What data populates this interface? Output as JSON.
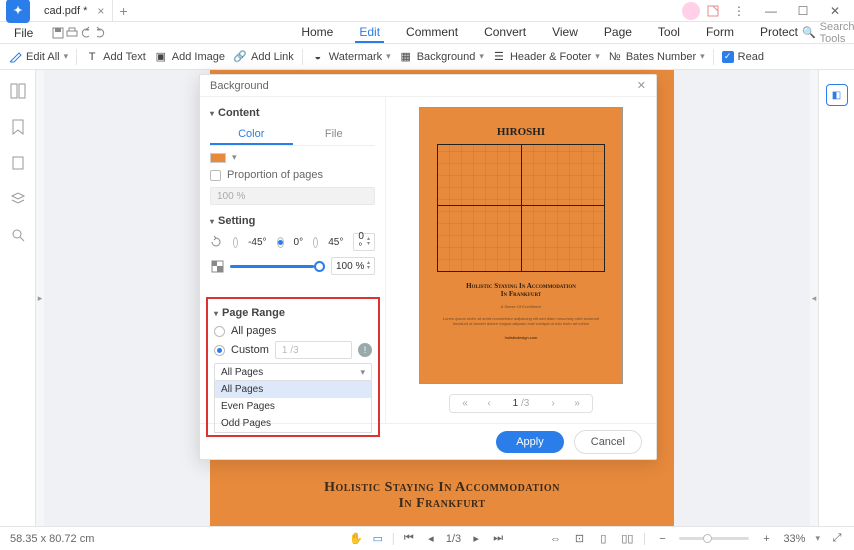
{
  "titlebar": {
    "tab_title": "cad.pdf *"
  },
  "menubar": {
    "file": "File",
    "tabs": [
      "Home",
      "Edit",
      "Comment",
      "Convert",
      "View",
      "Page",
      "Tool",
      "Form",
      "Protect"
    ],
    "active_index": 1,
    "search_placeholder": "Search Tools"
  },
  "toolbar": {
    "edit_all": "Edit All",
    "add_text": "Add Text",
    "add_image": "Add Image",
    "add_link": "Add Link",
    "watermark": "Watermark",
    "background": "Background",
    "header_footer": "Header & Footer",
    "bates_number": "Bates Number",
    "read": "Read"
  },
  "modal": {
    "title": "Background",
    "content_section": "Content",
    "tab_color": "Color",
    "tab_file": "File",
    "proportion_label": "Proportion of pages",
    "proportion_value": "100 %",
    "setting_section": "Setting",
    "angle_neg45": "-45°",
    "angle_0": "0°",
    "angle_45": "45°",
    "angle_input": "0 °",
    "opacity_input": "100 %",
    "page_range_section": "Page Range",
    "all_pages_radio": "All pages",
    "custom_radio": "Custom",
    "custom_placeholder": "1 /3",
    "select_value": "All Pages",
    "dd_options": [
      "All Pages",
      "Even Pages",
      "Odd Pages"
    ],
    "pager": {
      "page": "1",
      "total": "/3"
    },
    "apply": "Apply",
    "cancel": "Cancel"
  },
  "document": {
    "title": "HIROSHI",
    "subtitle1": "Holistic Staying In Accommodation",
    "subtitle2": "In Frankfurt",
    "byline": "A Sense Of Excellence",
    "url": "holisticdesign.com"
  },
  "statusbar": {
    "dims": "58.35 x 80.72 cm",
    "page": "1/3",
    "zoom": "33%"
  }
}
